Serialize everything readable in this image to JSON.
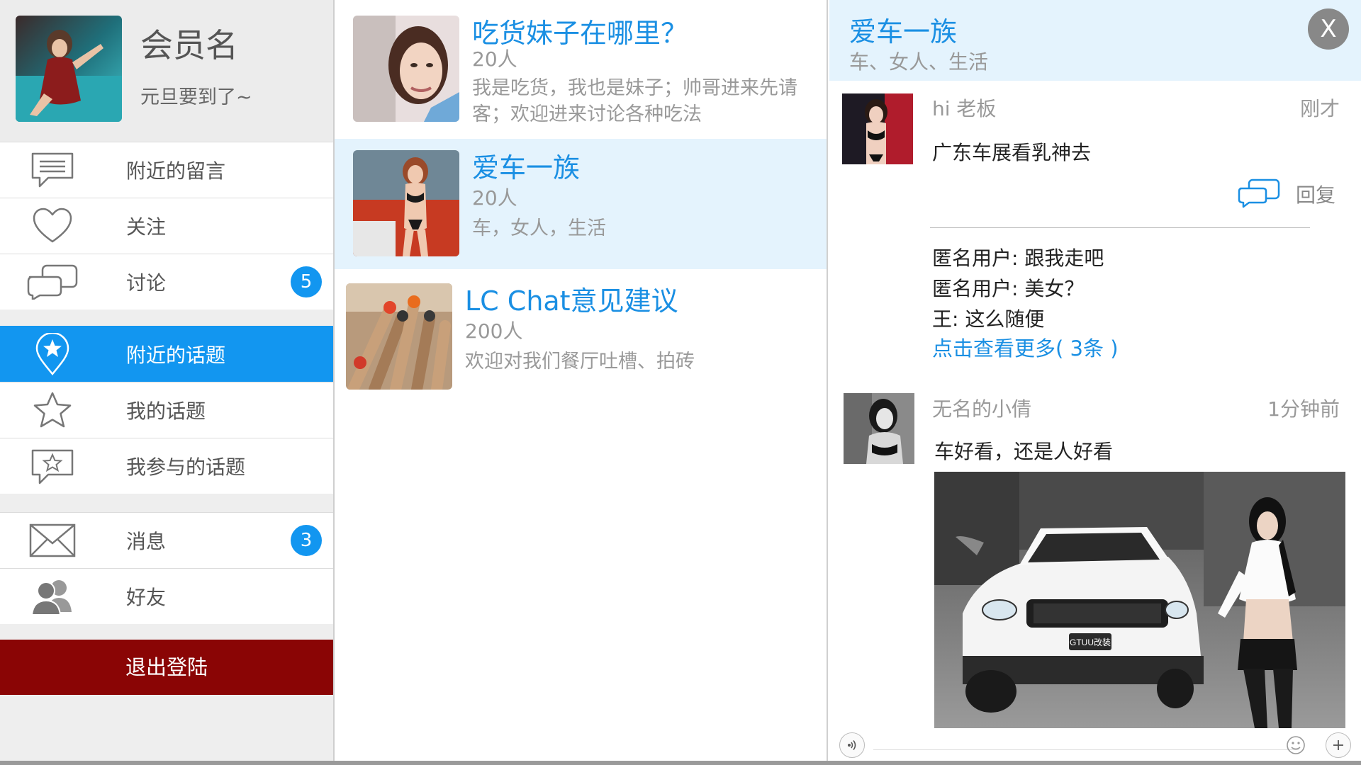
{
  "colors": {
    "accent": "#1296f0",
    "logout": "#8a0505",
    "selected_bg": "#e4f3fd",
    "link": "#1a8fe3"
  },
  "sidebar": {
    "profile": {
      "username": "会员名",
      "status": "元旦要到了~"
    },
    "menu_groups": [
      [
        {
          "label": "附近的留言",
          "icon": "message-lines-icon"
        },
        {
          "label": "关注",
          "icon": "heart-icon"
        },
        {
          "label": "讨论",
          "icon": "chat-bubbles-icon",
          "badge": "5"
        }
      ],
      [
        {
          "label": "附近的话题",
          "icon": "location-star-icon",
          "active": true
        },
        {
          "label": "我的话题",
          "icon": "star-icon"
        },
        {
          "label": "我参与的话题",
          "icon": "star-frame-icon"
        }
      ],
      [
        {
          "label": "消息",
          "icon": "envelope-icon",
          "badge": "3"
        },
        {
          "label": "好友",
          "icon": "friends-icon"
        }
      ]
    ],
    "logout_label": "退出登陆"
  },
  "topics": [
    {
      "name": "吃货妹子在哪里？",
      "members": "20人",
      "description": "我是吃货，我也是妹子；帅哥进来先请客；欢迎进来讨论各种吃法",
      "selected": false
    },
    {
      "name": "爱车一族",
      "members": "20人",
      "description": "车，女人，生活",
      "selected": true
    },
    {
      "name": "LC Chat意见建议",
      "members": "200人",
      "description": "欢迎对我们餐厅吐槽、拍砖",
      "selected": false
    }
  ],
  "detail": {
    "title": "爱车一族",
    "tags": "车、女人、生活",
    "close_label": "X",
    "posts": [
      {
        "user": "hi 老板",
        "time": "刚才",
        "text": "广东车展看乳神去",
        "reply_label": "回复",
        "comments": [
          "匿名用户: 跟我走吧",
          "匿名用户: 美女？",
          "王: 这么随便"
        ],
        "more_label": "点击查看更多( 3条 )"
      },
      {
        "user": "无名的小倩",
        "time": "1分钟前",
        "text": "车好看，还是人好看",
        "photo_plate": "GTUU改装"
      }
    ]
  }
}
